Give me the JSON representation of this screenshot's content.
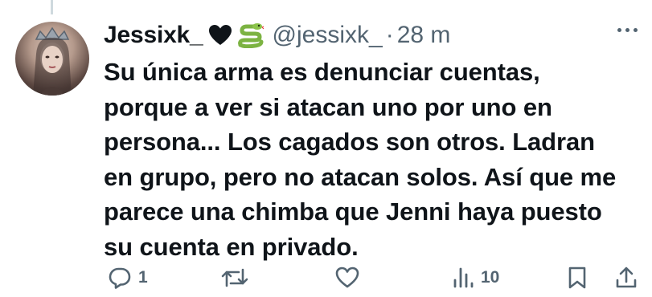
{
  "tweet": {
    "display_name": "Jessixk_",
    "name_emojis": [
      "black-heart-icon",
      "snake-icon"
    ],
    "handle": "@jessixk_",
    "separator": "·",
    "time": "28 m",
    "text": "Su única arma es denunciar cuentas,\nporque a ver si atacan uno por uno en\npersona... Los cagados son otros. Ladran\nen grupo, pero no atacan solos. Así que me\nparece una chimba que Jenni haya puesto\nsu cuenta en privado."
  },
  "actions": {
    "reply_count": "1",
    "repost_count": "",
    "like_count": "",
    "views_count": "10"
  },
  "icons": [
    "reply-icon",
    "repost-icon",
    "like-icon",
    "views-icon",
    "bookmark-icon",
    "share-icon",
    "more-icon"
  ],
  "colors": {
    "text": "#0f1419",
    "secondary": "#536471",
    "thread_line": "#cfd9de"
  }
}
